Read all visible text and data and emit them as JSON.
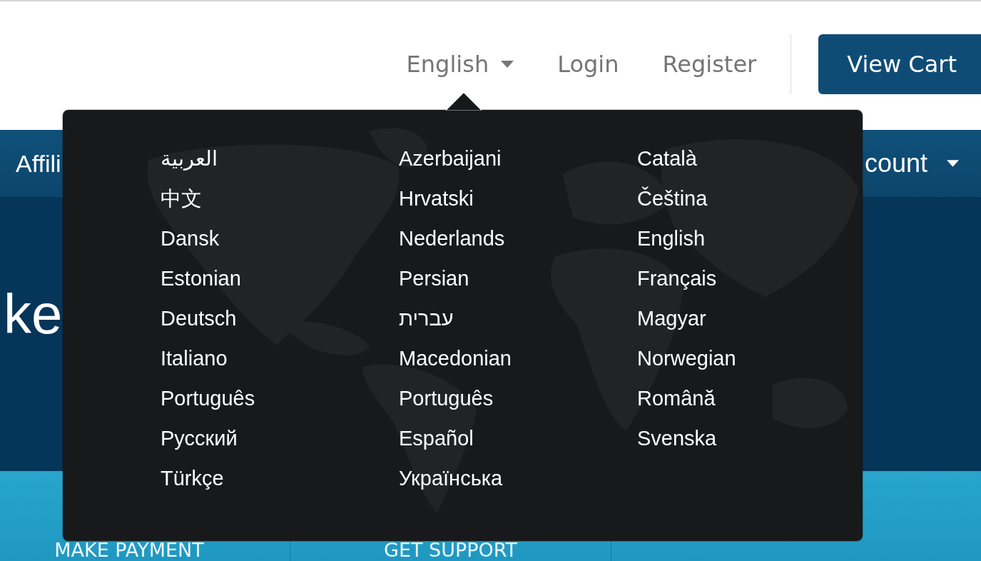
{
  "header": {
    "language_selector": {
      "label": "English"
    },
    "links": [
      {
        "label": "Login"
      },
      {
        "label": "Register"
      }
    ],
    "cart_button": {
      "label": "View Cart"
    }
  },
  "nav": {
    "items": [
      {
        "label": "Affili",
        "kind": "link"
      },
      {
        "label": "count",
        "kind": "dropdown"
      }
    ]
  },
  "hero": {
    "heading": "ke"
  },
  "action_tiles": [
    {
      "label": "MAKE PAYMENT"
    },
    {
      "label": "GET SUPPORT"
    }
  ],
  "language_menu": {
    "columns": [
      [
        "العربية",
        "中文",
        "Dansk",
        "Estonian",
        "Deutsch",
        "Italiano",
        "Português",
        "Русский",
        "Türkçe"
      ],
      [
        "Azerbaijani",
        "Hrvatski",
        "Nederlands",
        "Persian",
        "עברית",
        "Macedonian",
        "Português",
        "Español",
        "Українська"
      ],
      [
        "Català",
        "Čeština",
        "English",
        "Français",
        "Magyar",
        "Norwegian",
        "Română",
        "Svenska"
      ]
    ]
  }
}
